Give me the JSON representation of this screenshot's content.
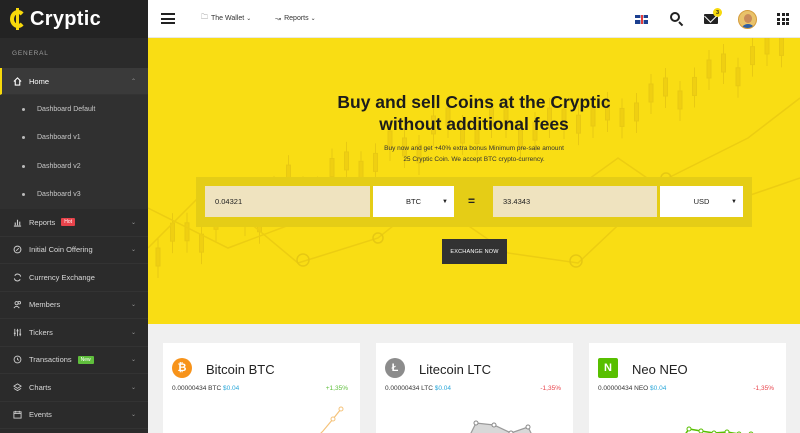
{
  "brand": {
    "name": "Cryptic"
  },
  "sidebar": {
    "section": "GENERAL",
    "home": {
      "label": "Home",
      "icon": "home-icon"
    },
    "home_sub": [
      {
        "label": "Dashboard Default"
      },
      {
        "label": "Dashboard v1"
      },
      {
        "label": "Dashboard v2"
      },
      {
        "label": "Dashboard v3"
      }
    ],
    "items": [
      {
        "label": "Reports",
        "icon": "bar-chart-icon",
        "tag": "Hot",
        "has_chevron": true
      },
      {
        "label": "Initial Coin Offering",
        "icon": "coin-icon",
        "has_chevron": true
      },
      {
        "label": "Currency Exchange",
        "icon": "exchange-icon",
        "has_chevron": false
      },
      {
        "label": "Members",
        "icon": "users-icon",
        "has_chevron": true
      },
      {
        "label": "Tickers",
        "icon": "sliders-icon",
        "has_chevron": true
      },
      {
        "label": "Transactions",
        "icon": "transactions-icon",
        "tag": "New",
        "has_chevron": true
      },
      {
        "label": "Charts",
        "icon": "layers-icon",
        "has_chevron": true
      },
      {
        "label": "Events",
        "icon": "calendar-icon",
        "has_chevron": true
      }
    ]
  },
  "topbar": {
    "wallet": "The Wallet",
    "reports": "Reports",
    "notification_count": "3"
  },
  "hero": {
    "title_line1": "Buy and sell Coins at the Cryptic",
    "title_line2": "without additional fees",
    "subtitle_line1": "Buy now and get +40% extra bonus Minimum pre-sale amount",
    "subtitle_line2": "25 Cryptic Coin. We accept BTC crypto-currency.",
    "from_value": "0.04321",
    "from_currency": "BTC",
    "equals": "=",
    "to_value": "33.4343",
    "to_currency": "USD",
    "button": "EXCHANGE NOW"
  },
  "cards": [
    {
      "name": "Bitcoin BTC",
      "amount": "0.00000434 BTC",
      "usd": "$0.04",
      "change": "+1,35%",
      "color": "#f7931a",
      "icon": "bitcoin-icon"
    },
    {
      "name": "Litecoin LTC",
      "amount": "0.00000434 LTC",
      "usd": "$0.04",
      "change": "-1,35%",
      "color": "#8c8c8c",
      "icon": "litecoin-icon"
    },
    {
      "name": "Neo NEO",
      "amount": "0.00000434 NEO",
      "usd": "$0.04",
      "change": "-1,35%",
      "color": "#58bf00",
      "icon": "neo-icon"
    }
  ]
}
